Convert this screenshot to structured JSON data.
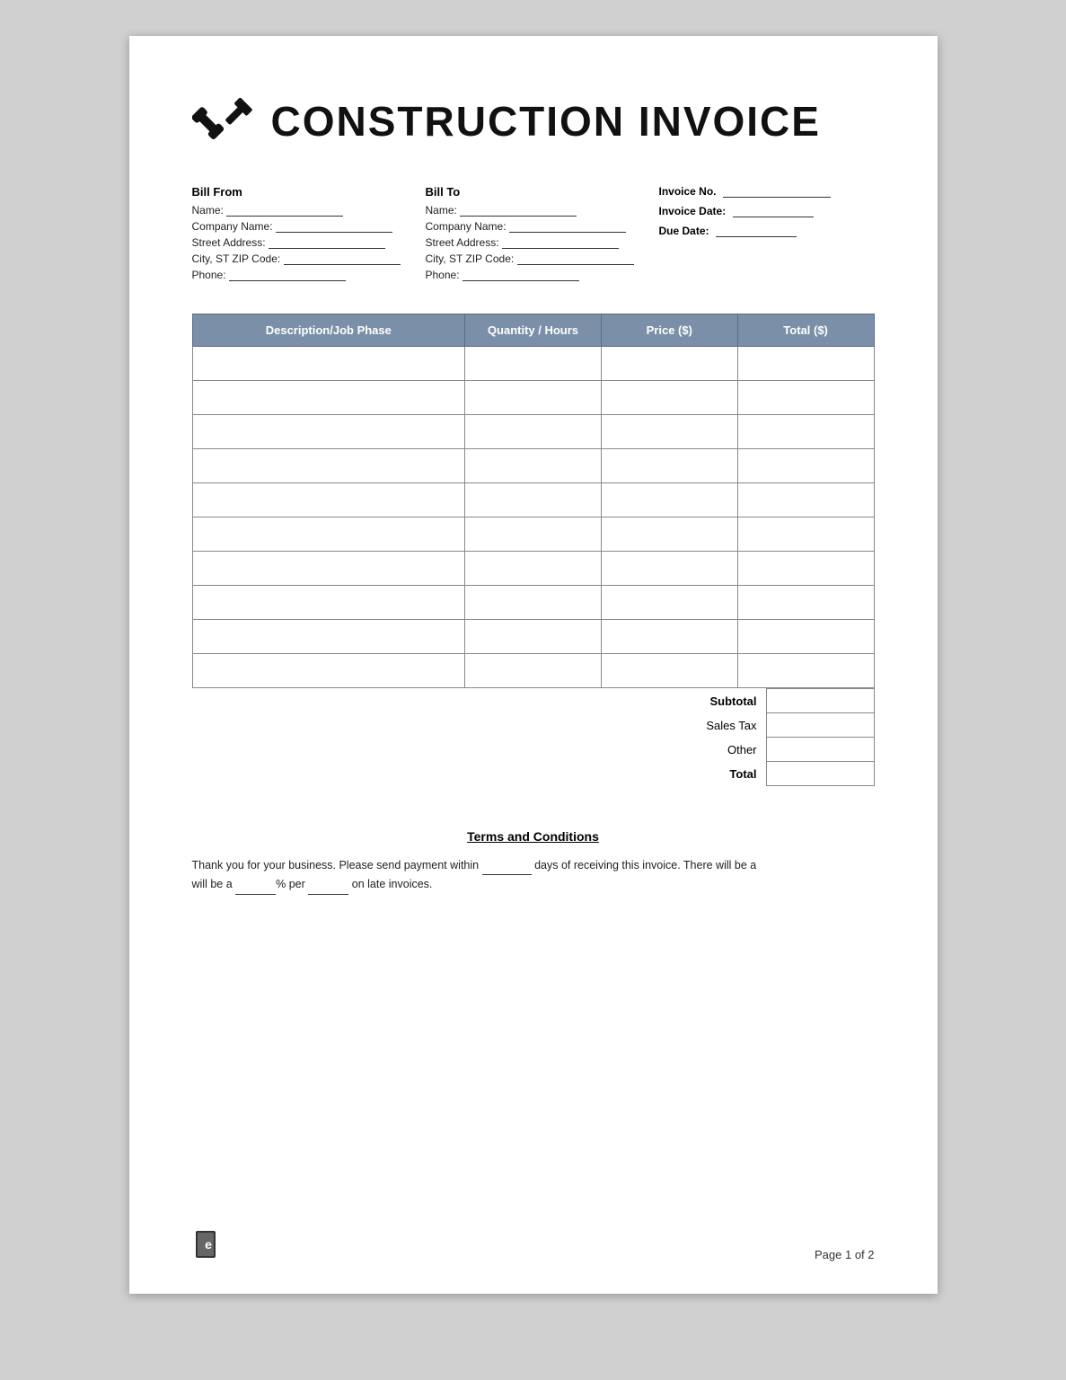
{
  "header": {
    "title": "CONSTRUCTION INVOICE"
  },
  "bill_from": {
    "label": "Bill From",
    "name_label": "Name:",
    "company_label": "Company Name:",
    "street_label": "Street Address:",
    "city_label": "City, ST ZIP Code:",
    "phone_label": "Phone:"
  },
  "bill_to": {
    "label": "Bill To",
    "name_label": "Name:",
    "company_label": "Company Name:",
    "street_label": "Street Address:",
    "city_label": "City, ST ZIP Code:",
    "phone_label": "Phone:"
  },
  "invoice_meta": {
    "invoice_no_label": "Invoice No.",
    "invoice_date_label": "Invoice Date:",
    "due_date_label": "Due Date:"
  },
  "table": {
    "headers": [
      "Description/Job Phase",
      "Quantity / Hours",
      "Price ($)",
      "Total ($)"
    ],
    "rows": 10
  },
  "totals": {
    "subtotal_label": "Subtotal",
    "sales_tax_label": "Sales Tax",
    "other_label": "Other",
    "total_label": "Total"
  },
  "terms": {
    "title": "Terms and Conditions",
    "text_part1": "Thank you for your business. Please send payment within",
    "text_part2": "days of receiving this invoice. There will be a",
    "text_part3": "% per",
    "text_part4": "on late invoices."
  },
  "footer": {
    "page_label": "Page 1 of 2"
  }
}
